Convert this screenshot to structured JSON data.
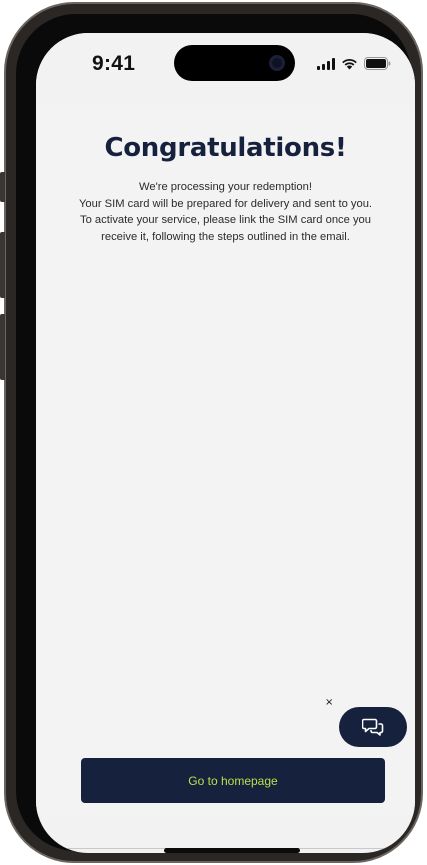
{
  "status_bar": {
    "time": "9:41",
    "icons": [
      "cellular-signal-icon",
      "wifi-icon",
      "battery-icon"
    ]
  },
  "page": {
    "title": "Congratulations!",
    "message_lines": [
      "We're processing your redemption!",
      "Your SIM card will be prepared for delivery and sent to you. To activate your service, please link the SIM card once you receive it, following the steps outlined in the email."
    ]
  },
  "chat_widget": {
    "close_label": "×",
    "icon": "chat-bubbles-icon"
  },
  "actions": {
    "home_label": "Go to homepage"
  },
  "colors": {
    "brand_navy": "#16213e",
    "button_text_lime": "#b5e04a",
    "background": "#f3f3f4"
  }
}
